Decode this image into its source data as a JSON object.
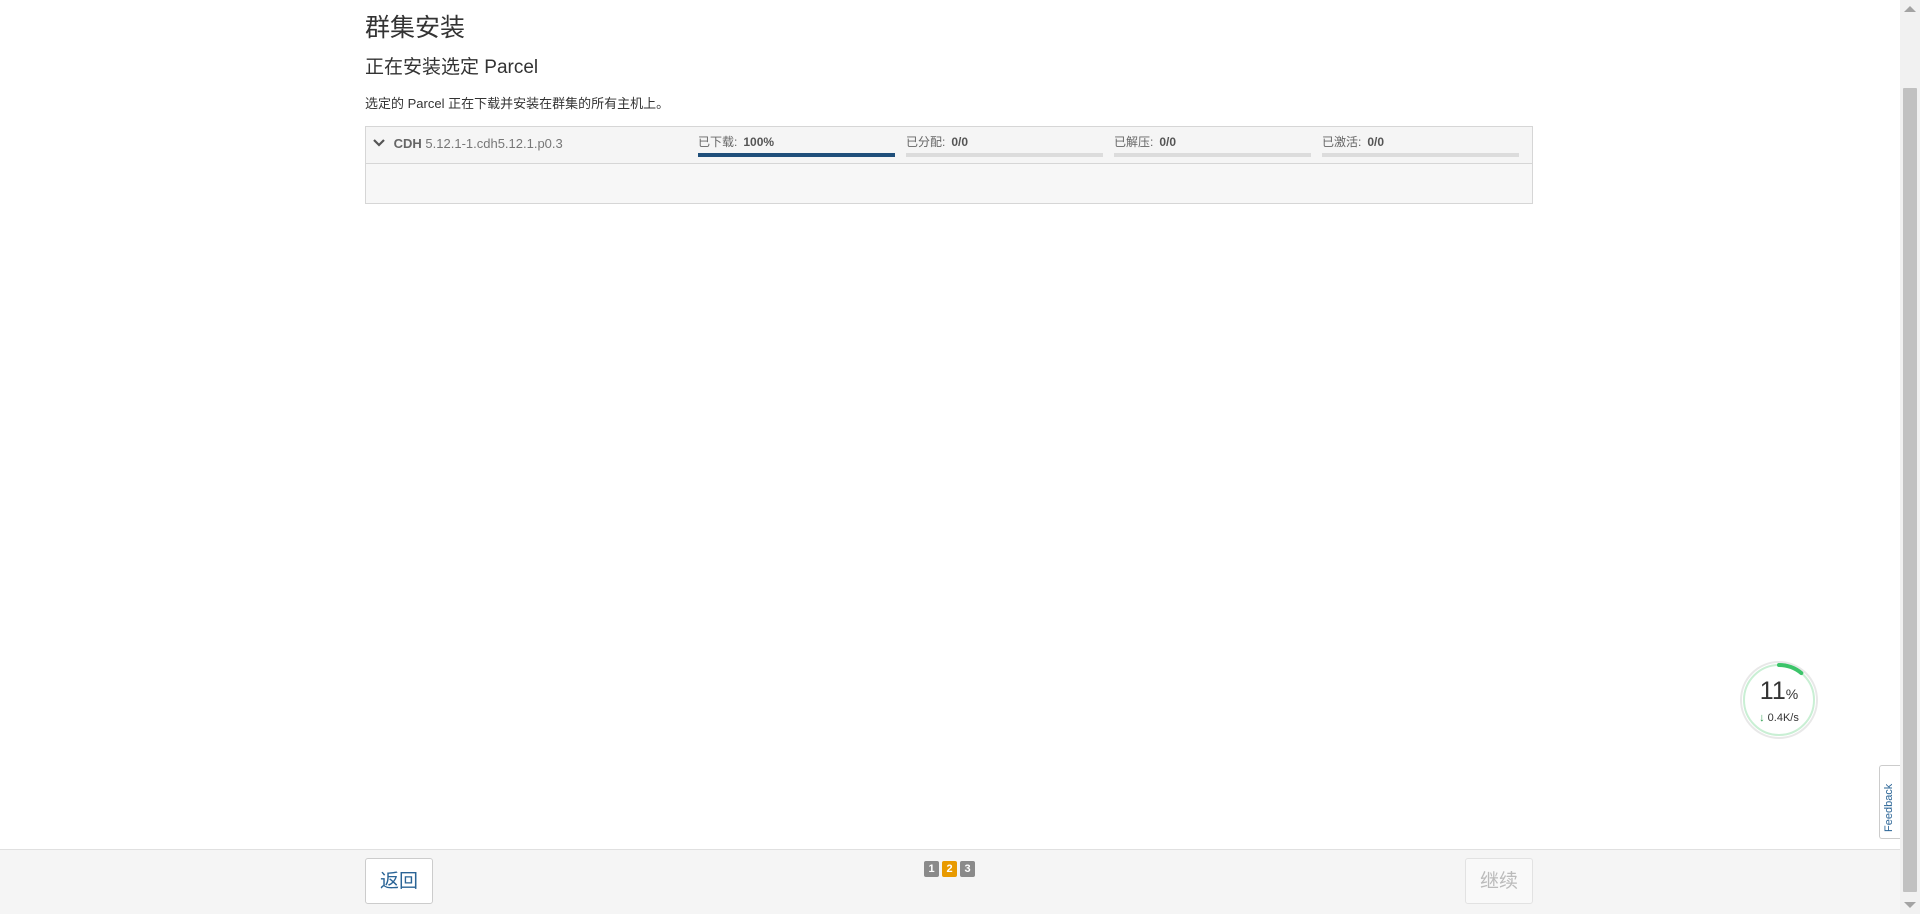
{
  "header": {
    "title": "群集安装",
    "subtitle": "正在安装选定 Parcel",
    "description": "选定的 Parcel 正在下载并安装在群集的所有主机上。"
  },
  "parcel": {
    "product": "CDH",
    "version": "5.12.1-1.cdh5.12.1.p0.3",
    "stats": [
      {
        "label": "已下载:",
        "value": "100%",
        "progress": 1.0
      },
      {
        "label": "已分配:",
        "value": "0/0",
        "progress": 0
      },
      {
        "label": "已解压:",
        "value": "0/0",
        "progress": 0
      },
      {
        "label": "已激活:",
        "value": "0/0",
        "progress": 0
      }
    ]
  },
  "footer": {
    "back_label": "返回",
    "next_label": "继续",
    "steps": [
      "1",
      "2",
      "3"
    ],
    "active_step": "2"
  },
  "speed_widget": {
    "percent": "11",
    "percent_unit": "%",
    "rate": "0.4K/s",
    "progress": 0.11
  },
  "feedback": {
    "label": "Feedback"
  },
  "colors": {
    "progress_fill": "#1f4f7a",
    "active_step": "#e89a00",
    "link": "#2a6496",
    "speed_ring": "#3cc46a"
  }
}
